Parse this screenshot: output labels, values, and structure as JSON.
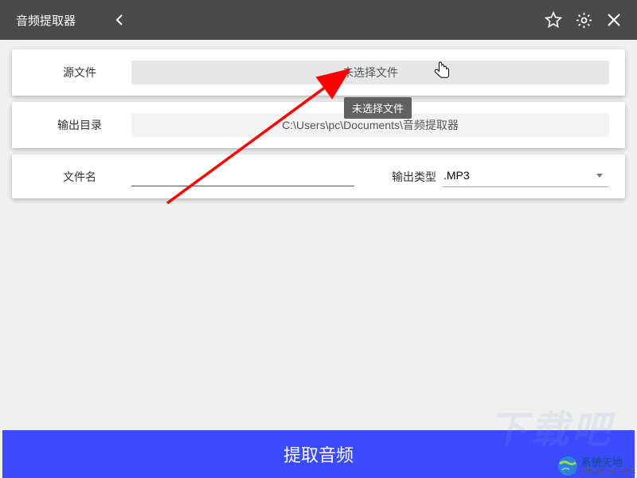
{
  "header": {
    "title": "音频提取器"
  },
  "sourceFile": {
    "label": "源文件",
    "buttonText": "未选择文件",
    "tooltip": "未选择文件"
  },
  "outputDir": {
    "label": "输出目录",
    "value": "C:\\Users\\pc\\Documents\\音频提取器"
  },
  "fileName": {
    "label": "文件名",
    "value": ""
  },
  "outputType": {
    "label": "输出类型",
    "selected": ".MP3"
  },
  "extractButton": {
    "label": "提取音频"
  },
  "watermark": {
    "cn": "系统天地",
    "en": "XiTongTianDi.net",
    "bg": "下载吧"
  }
}
